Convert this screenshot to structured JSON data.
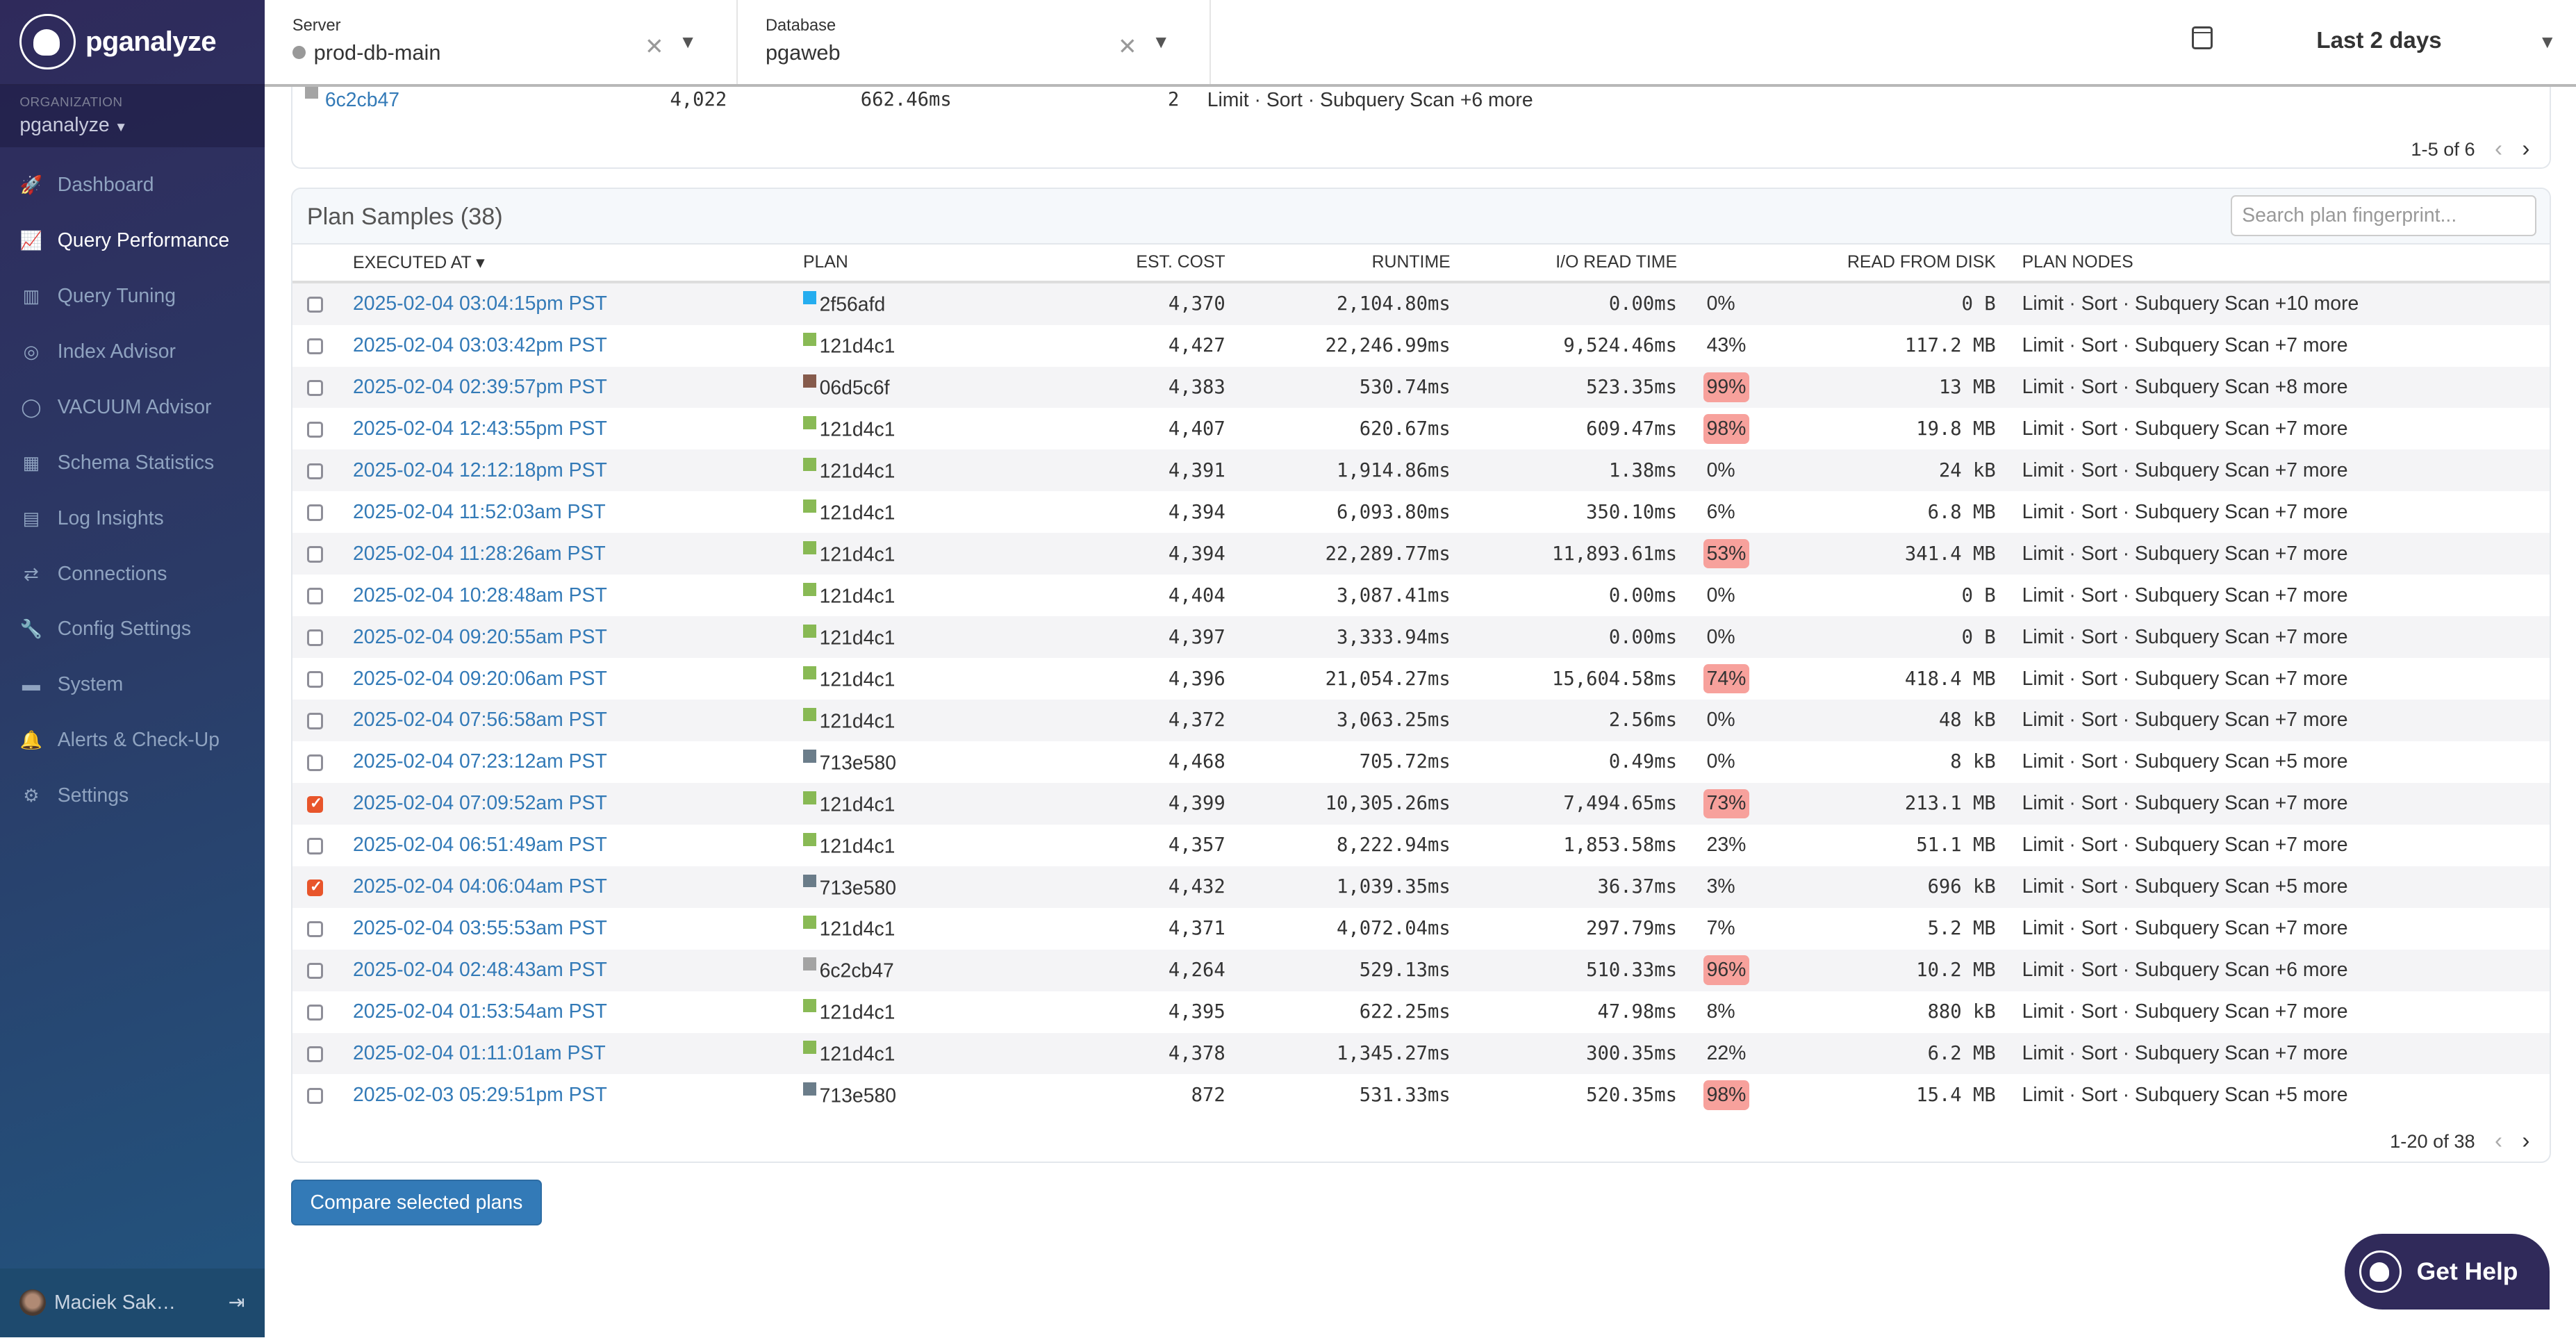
{
  "sidebar": {
    "brand": "pganalyze",
    "org_label": "ORGANIZATION",
    "org_name": "pganalyze",
    "items": [
      {
        "label": "Dashboard",
        "icon": "rocket-icon",
        "glyph": "🚀",
        "active": false
      },
      {
        "label": "Query Performance",
        "icon": "chart-line-icon",
        "glyph": "📈",
        "active": true
      },
      {
        "label": "Query Tuning",
        "icon": "books-icon",
        "glyph": "▥",
        "active": false
      },
      {
        "label": "Index Advisor",
        "icon": "target-icon",
        "glyph": "◎",
        "active": false
      },
      {
        "label": "VACUUM Advisor",
        "icon": "circle-notch-icon",
        "glyph": "◯",
        "active": false
      },
      {
        "label": "Schema Statistics",
        "icon": "table-icon",
        "glyph": "▦",
        "active": false
      },
      {
        "label": "Log Insights",
        "icon": "archive-icon",
        "glyph": "▤",
        "active": false
      },
      {
        "label": "Connections",
        "icon": "arrows-exchange-icon",
        "glyph": "⇄",
        "active": false
      },
      {
        "label": "Config Settings",
        "icon": "wrench-icon",
        "glyph": "🔧",
        "active": false
      },
      {
        "label": "System",
        "icon": "server-icon",
        "glyph": "▬",
        "active": false
      },
      {
        "label": "Alerts & Check-Up",
        "icon": "bell-icon",
        "glyph": "🔔",
        "active": false
      },
      {
        "label": "Settings",
        "icon": "gear-icon",
        "glyph": "⚙",
        "active": false
      }
    ],
    "user_name": "Maciek Sak…",
    "logout_glyph": "⇥"
  },
  "topbar": {
    "server_label": "Server",
    "server_value": "prod-db-main",
    "database_label": "Database",
    "database_value": "pgaweb",
    "clear_glyph": "✕",
    "caret_glyph": "▼",
    "date_range": "Last 2 days"
  },
  "prev_table": {
    "row": {
      "plan": "6c2cb47",
      "cost": "4,022",
      "runtime": "662.46ms",
      "count": "2",
      "nodes": "Limit · Sort · Subquery Scan +6 more"
    },
    "pager": "1-5 of 6"
  },
  "plan_samples": {
    "title": "Plan Samples (38)",
    "search_placeholder": "Search plan fingerprint...",
    "columns": {
      "executed_at": "EXECUTED AT ▾",
      "plan": "PLAN",
      "est_cost": "EST. COST",
      "runtime": "RUNTIME",
      "io_read_time": "I/O READ TIME",
      "read_from_disk": "READ FROM DISK",
      "plan_nodes": "PLAN NODES"
    },
    "plan_colors": {
      "2f56afd": "#0ea5ee",
      "121d4c1": "#7cb342",
      "06d5c6f": "#7a4a3a",
      "713e580": "#5b6f7d",
      "6c2cb47": "#9a9a9a"
    },
    "highlight_color": "#f7a19c",
    "rows": [
      {
        "checked": false,
        "executed_at": "2025-02-04 03:04:15pm PST",
        "plan": "2f56afd",
        "cost": "4,370",
        "runtime": "2,104.80ms",
        "io": "0.00ms",
        "pct": "0%",
        "hot": false,
        "disk": "0 B",
        "nodes": "Limit · Sort · Subquery Scan +10 more"
      },
      {
        "checked": false,
        "executed_at": "2025-02-04 03:03:42pm PST",
        "plan": "121d4c1",
        "cost": "4,427",
        "runtime": "22,246.99ms",
        "io": "9,524.46ms",
        "pct": "43%",
        "hot": false,
        "disk": "117.2 MB",
        "nodes": "Limit · Sort · Subquery Scan +7 more"
      },
      {
        "checked": false,
        "executed_at": "2025-02-04 02:39:57pm PST",
        "plan": "06d5c6f",
        "cost": "4,383",
        "runtime": "530.74ms",
        "io": "523.35ms",
        "pct": "99%",
        "hot": true,
        "disk": "13 MB",
        "nodes": "Limit · Sort · Subquery Scan +8 more"
      },
      {
        "checked": false,
        "executed_at": "2025-02-04 12:43:55pm PST",
        "plan": "121d4c1",
        "cost": "4,407",
        "runtime": "620.67ms",
        "io": "609.47ms",
        "pct": "98%",
        "hot": true,
        "disk": "19.8 MB",
        "nodes": "Limit · Sort · Subquery Scan +7 more"
      },
      {
        "checked": false,
        "executed_at": "2025-02-04 12:12:18pm PST",
        "plan": "121d4c1",
        "cost": "4,391",
        "runtime": "1,914.86ms",
        "io": "1.38ms",
        "pct": "0%",
        "hot": false,
        "disk": "24 kB",
        "nodes": "Limit · Sort · Subquery Scan +7 more"
      },
      {
        "checked": false,
        "executed_at": "2025-02-04 11:52:03am PST",
        "plan": "121d4c1",
        "cost": "4,394",
        "runtime": "6,093.80ms",
        "io": "350.10ms",
        "pct": "6%",
        "hot": false,
        "disk": "6.8 MB",
        "nodes": "Limit · Sort · Subquery Scan +7 more"
      },
      {
        "checked": false,
        "executed_at": "2025-02-04 11:28:26am PST",
        "plan": "121d4c1",
        "cost": "4,394",
        "runtime": "22,289.77ms",
        "io": "11,893.61ms",
        "pct": "53%",
        "hot": true,
        "disk": "341.4 MB",
        "nodes": "Limit · Sort · Subquery Scan +7 more"
      },
      {
        "checked": false,
        "executed_at": "2025-02-04 10:28:48am PST",
        "plan": "121d4c1",
        "cost": "4,404",
        "runtime": "3,087.41ms",
        "io": "0.00ms",
        "pct": "0%",
        "hot": false,
        "disk": "0 B",
        "nodes": "Limit · Sort · Subquery Scan +7 more"
      },
      {
        "checked": false,
        "executed_at": "2025-02-04 09:20:55am PST",
        "plan": "121d4c1",
        "cost": "4,397",
        "runtime": "3,333.94ms",
        "io": "0.00ms",
        "pct": "0%",
        "hot": false,
        "disk": "0 B",
        "nodes": "Limit · Sort · Subquery Scan +7 more"
      },
      {
        "checked": false,
        "executed_at": "2025-02-04 09:20:06am PST",
        "plan": "121d4c1",
        "cost": "4,396",
        "runtime": "21,054.27ms",
        "io": "15,604.58ms",
        "pct": "74%",
        "hot": true,
        "disk": "418.4 MB",
        "nodes": "Limit · Sort · Subquery Scan +7 more"
      },
      {
        "checked": false,
        "executed_at": "2025-02-04 07:56:58am PST",
        "plan": "121d4c1",
        "cost": "4,372",
        "runtime": "3,063.25ms",
        "io": "2.56ms",
        "pct": "0%",
        "hot": false,
        "disk": "48 kB",
        "nodes": "Limit · Sort · Subquery Scan +7 more"
      },
      {
        "checked": false,
        "executed_at": "2025-02-04 07:23:12am PST",
        "plan": "713e580",
        "cost": "4,468",
        "runtime": "705.72ms",
        "io": "0.49ms",
        "pct": "0%",
        "hot": false,
        "disk": "8 kB",
        "nodes": "Limit · Sort · Subquery Scan +5 more"
      },
      {
        "checked": true,
        "executed_at": "2025-02-04 07:09:52am PST",
        "plan": "121d4c1",
        "cost": "4,399",
        "runtime": "10,305.26ms",
        "io": "7,494.65ms",
        "pct": "73%",
        "hot": true,
        "disk": "213.1 MB",
        "nodes": "Limit · Sort · Subquery Scan +7 more"
      },
      {
        "checked": false,
        "executed_at": "2025-02-04 06:51:49am PST",
        "plan": "121d4c1",
        "cost": "4,357",
        "runtime": "8,222.94ms",
        "io": "1,853.58ms",
        "pct": "23%",
        "hot": false,
        "disk": "51.1 MB",
        "nodes": "Limit · Sort · Subquery Scan +7 more"
      },
      {
        "checked": true,
        "executed_at": "2025-02-04 04:06:04am PST",
        "plan": "713e580",
        "cost": "4,432",
        "runtime": "1,039.35ms",
        "io": "36.37ms",
        "pct": "3%",
        "hot": false,
        "disk": "696 kB",
        "nodes": "Limit · Sort · Subquery Scan +5 more"
      },
      {
        "checked": false,
        "executed_at": "2025-02-04 03:55:53am PST",
        "plan": "121d4c1",
        "cost": "4,371",
        "runtime": "4,072.04ms",
        "io": "297.79ms",
        "pct": "7%",
        "hot": false,
        "disk": "5.2 MB",
        "nodes": "Limit · Sort · Subquery Scan +7 more"
      },
      {
        "checked": false,
        "executed_at": "2025-02-04 02:48:43am PST",
        "plan": "6c2cb47",
        "cost": "4,264",
        "runtime": "529.13ms",
        "io": "510.33ms",
        "pct": "96%",
        "hot": true,
        "disk": "10.2 MB",
        "nodes": "Limit · Sort · Subquery Scan +6 more"
      },
      {
        "checked": false,
        "executed_at": "2025-02-04 01:53:54am PST",
        "plan": "121d4c1",
        "cost": "4,395",
        "runtime": "622.25ms",
        "io": "47.98ms",
        "pct": "8%",
        "hot": false,
        "disk": "880 kB",
        "nodes": "Limit · Sort · Subquery Scan +7 more"
      },
      {
        "checked": false,
        "executed_at": "2025-02-04 01:11:01am PST",
        "plan": "121d4c1",
        "cost": "4,378",
        "runtime": "1,345.27ms",
        "io": "300.35ms",
        "pct": "22%",
        "hot": false,
        "disk": "6.2 MB",
        "nodes": "Limit · Sort · Subquery Scan +7 more"
      },
      {
        "checked": false,
        "executed_at": "2025-02-03 05:29:51pm PST",
        "plan": "713e580",
        "cost": "872",
        "runtime": "531.33ms",
        "io": "520.35ms",
        "pct": "98%",
        "hot": true,
        "disk": "15.4 MB",
        "nodes": "Limit · Sort · Subquery Scan +5 more"
      }
    ],
    "pager": "1-20 of 38"
  },
  "pager_glyphs": {
    "prev": "‹",
    "next": "›"
  },
  "actions": {
    "compare_label": "Compare selected plans",
    "help_label": "Get Help"
  }
}
